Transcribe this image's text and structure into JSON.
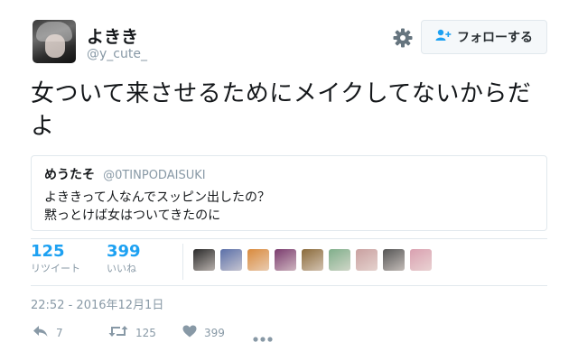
{
  "author": {
    "display_name": "よきき",
    "screen_name": "@y_cute_"
  },
  "header": {
    "gear_icon": "gear-icon",
    "follow_label": "フォローする",
    "follow_icon": "person-plus-icon"
  },
  "tweet": {
    "text": "女ついて来させるためにメイクしてないからだよ"
  },
  "quote": {
    "author_name": "めうたそ",
    "author_handle": "@0TINPODAISUKI",
    "line1": "よききって人なんでスッピン出したの？",
    "line2": "黙っとけば女はついてきたのに"
  },
  "stats": {
    "retweets_count": "125",
    "retweets_label": "リツイート",
    "likes_count": "399",
    "likes_label": "いいね"
  },
  "likers": [
    {
      "color": "#2a2a2a"
    },
    {
      "color": "#5a6fa8"
    },
    {
      "color": "#d98a3c"
    },
    {
      "color": "#7a3b6e"
    },
    {
      "color": "#8a6a3a"
    },
    {
      "color": "#7fae8a"
    },
    {
      "color": "#c9a0a0"
    },
    {
      "color": "#555555"
    },
    {
      "color": "#d9a0b0"
    }
  ],
  "timestamp": "22:52 - 2016年12月1日",
  "actions": {
    "reply_count": "7",
    "retweet_count": "125",
    "like_count": "399"
  },
  "colors": {
    "accent": "#1da1f2",
    "muted": "#8899a6",
    "border": "#e1e8ed"
  }
}
